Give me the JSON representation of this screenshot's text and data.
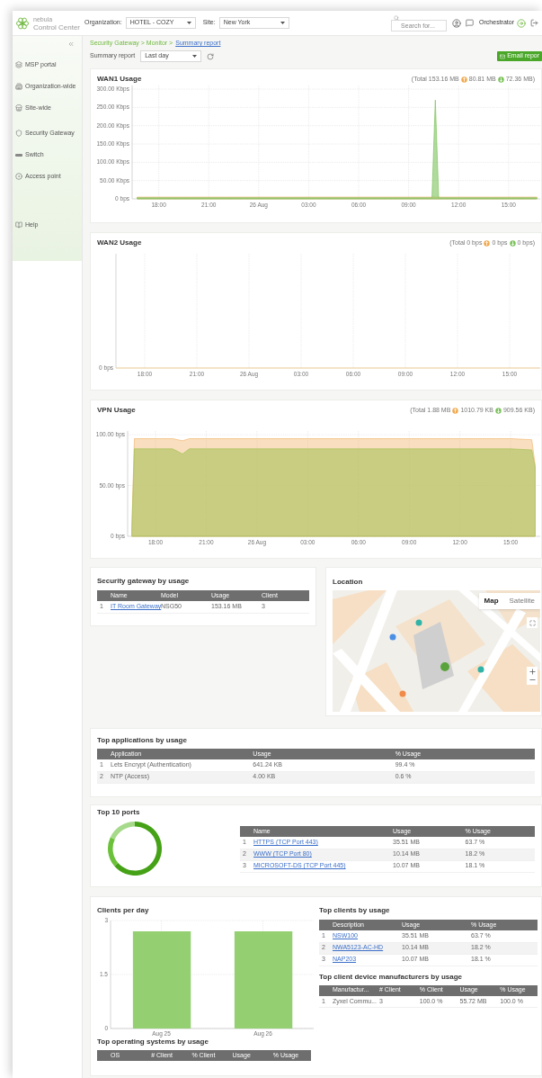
{
  "header": {
    "brand": "nebula",
    "subtitle": "Control Center",
    "organization_label": "Organization:",
    "organization": "HOTEL - COZY",
    "site_label": "Site:",
    "site": "New York",
    "search": {
      "placeholder": "Search for..."
    },
    "user": "Orchestrator"
  },
  "sidebar": {
    "sections": [
      {
        "items": [
          {
            "label": "MSP portal"
          },
          {
            "label": "Organization-wide"
          },
          {
            "label": "Site-wide"
          }
        ]
      },
      {
        "items": [
          {
            "label": "Security Gateway"
          },
          {
            "label": "Switch"
          },
          {
            "label": "Access point"
          }
        ]
      },
      {
        "items": [
          {
            "label": "Help"
          }
        ]
      }
    ]
  },
  "breadcrumb": {
    "path": "Security Gateway > Monitor >",
    "current": "Summary report"
  },
  "toolbar": {
    "label": "Summary report",
    "period": "Last day",
    "email_button": "Email repor"
  },
  "usage_charts": [
    {
      "title": "WAN1 Usage",
      "total": "(Total 153.16 MB",
      "upload": "80.81 MB",
      "download": "72.36 MB)",
      "chart_data": {
        "type": "area",
        "grid": true,
        "x": [
          "--08-25T16:42",
          "--08-25T18:00",
          "--08-25T20:00",
          "--08-25T22:00",
          "--08-26T00:00",
          "--08-26T02:00",
          "--08-26T04:00",
          "--08-26T06:00",
          "--08-26T08:00",
          "--08-26T10:00",
          "--08-26T10:24",
          "--08-26T10:36",
          "--08-26T10:48",
          "--08-26T12:00",
          "--08-26T14:00",
          "--08-26T16:00",
          "--08-26T16:42"
        ],
        "series": [
          {
            "color": "#f2b872",
            "values": [
              5,
              5,
              5,
              5,
              5,
              5,
              5,
              5,
              5,
              5,
              5,
              5,
              5,
              5,
              5,
              5,
              5
            ]
          },
          {
            "color": "#7cc35c",
            "values": [
              3,
              3,
              3,
              3,
              3,
              3,
              3,
              3,
              3,
              3,
              3,
              270,
              3,
              3,
              3,
              3,
              3
            ]
          }
        ],
        "xlim": [
          "--08-25T16:24",
          "--08-26T16:54"
        ],
        "ylim": [
          0,
          300
        ],
        "xticks": [
          {
            "value": "--08-25T18:00",
            "label": "18:00"
          },
          {
            "value": "--08-25T21:00",
            "label": "21:00"
          },
          {
            "value": "--08-26T00:00",
            "label": "26 Aug"
          },
          {
            "value": "--08-26T03:00",
            "label": "03:00"
          },
          {
            "value": "--08-26T06:00",
            "label": "06:00"
          },
          {
            "value": "--08-26T09:00",
            "label": "09:00"
          },
          {
            "value": "--08-26T12:00",
            "label": "12:00"
          },
          {
            "value": "--08-26T15:00",
            "label": "15:00"
          }
        ],
        "yticks": [
          {
            "value": 0,
            "label": "0 bps"
          },
          {
            "value": 50,
            "label": "50.00 Kbps"
          },
          {
            "value": 100,
            "label": "100.00 Kbps"
          },
          {
            "value": 150,
            "label": "150.00 Kbps"
          },
          {
            "value": 200,
            "label": "200.00 Kbps"
          },
          {
            "value": 250,
            "label": "250.00 Kbps"
          },
          {
            "value": 300,
            "label": "300.00 Kbps"
          }
        ]
      }
    },
    {
      "title": "WAN2 Usage",
      "total": "(Total 0 bps",
      "upload": "0 bps",
      "download": "0 bps)",
      "axis": {
        "y_label": "0 bps",
        "x_labels": [
          "18:00",
          "21:00",
          "26 Aug",
          "03:00",
          "06:00",
          "09:00",
          "12:00",
          "15:00"
        ]
      }
    },
    {
      "title": "VPN Usage",
      "total": "(Total 1.88 MB",
      "upload": "1010.79 KB",
      "download": "909.56 KB)",
      "chart_data": {
        "type": "area",
        "grid": true,
        "x": [
          "--08-25T16:36",
          "--08-25T16:45",
          "--08-25T18:00",
          "--08-25T19:00",
          "--08-25T19:36",
          "--08-25T20:00",
          "--08-25T21:00",
          "--08-26T00:00",
          "--08-26T03:00",
          "--08-26T06:00",
          "--08-26T09:00",
          "--08-26T12:00",
          "--08-26T15:00",
          "--08-26T16:15",
          "--08-26T16:27"
        ],
        "series": [
          {
            "color": "#f2b872",
            "values": [
              10,
              96,
              96,
              96,
              94,
              96,
              96,
              96,
              96,
              96,
              96,
              96,
              96,
              95,
              70
            ]
          },
          {
            "color": "#a8c25a",
            "values": [
              5,
              86,
              86,
              86,
              81,
              86,
              86,
              86,
              86,
              86,
              86,
              86,
              86,
              85,
              68
            ]
          }
        ],
        "xlim": [
          "--08-25T16:21",
          "--08-26T16:45"
        ],
        "ylim": [
          0,
          100
        ],
        "xticks": [
          {
            "value": "--08-25T18:00",
            "label": "18:00"
          },
          {
            "value": "--08-25T21:00",
            "label": "21:00"
          },
          {
            "value": "--08-26T00:00",
            "label": "26 Aug"
          },
          {
            "value": "--08-26T03:00",
            "label": "03:00"
          },
          {
            "value": "--08-26T06:00",
            "label": "06:00"
          },
          {
            "value": "--08-26T09:00",
            "label": "09:00"
          },
          {
            "value": "--08-26T12:00",
            "label": "12:00"
          },
          {
            "value": "--08-26T15:00",
            "label": "15:00"
          }
        ],
        "yticks": [
          {
            "value": 0,
            "label": "0 bps"
          },
          {
            "value": 50,
            "label": "50.00 bps"
          },
          {
            "value": 100,
            "label": "100.00 bps"
          }
        ]
      }
    }
  ],
  "gateway_usage": {
    "title": "Security gateway by usage",
    "table": {
      "columns": [
        "",
        "Name",
        "Model",
        "Usage",
        "Client"
      ],
      "rows": [
        {
          "cells": [
            "1",
            "IT Room Gateway",
            "NSG50",
            "153.16 MB",
            "3"
          ]
        }
      ]
    }
  },
  "location": {
    "title": "Location",
    "map_types": [
      {
        "label": "Map",
        "selected": true
      },
      {
        "label": "Satellite",
        "selected": false
      }
    ]
  },
  "top_applications": {
    "title": "Top applications by usage",
    "table": {
      "columns": [
        "",
        "Application",
        "Usage",
        "% Usage"
      ],
      "rows": [
        {
          "cells": [
            "1",
            "Lets Encrypt (Authentication)",
            "641.24 KB",
            "99.4 %"
          ]
        },
        {
          "cells": [
            "2",
            "NTP (Access)",
            "4.00 KB",
            "0.6 %"
          ]
        }
      ]
    }
  },
  "top_ports": {
    "title": "Top 10 ports",
    "chart_data": {
      "type": "donut",
      "values": [
        63.7,
        18.2,
        18.1
      ],
      "colors": [
        "#45a116",
        "#6cc13a",
        "#a6d98a"
      ]
    },
    "table": {
      "columns": [
        "",
        "Name",
        "Usage",
        "% Usage"
      ],
      "rows": [
        {
          "cells": [
            "1",
            "HTTPS (TCP Port 443)",
            "35.51 MB",
            "63.7 %"
          ]
        },
        {
          "cells": [
            "2",
            "WWW (TCP Port 80)",
            "10.14 MB",
            "18.2 %"
          ]
        },
        {
          "cells": [
            "3",
            "MICROSOFT-DS (TCP Port 445)",
            "10.07 MB",
            "18.1 %"
          ]
        }
      ]
    }
  },
  "clients_per_day": {
    "title": "Clients per day",
    "chart_data": {
      "type": "bar",
      "grid": true,
      "categories": [
        "Aug 25",
        "Aug 26"
      ],
      "values": [
        2.7,
        2.7
      ],
      "ylim": [
        0,
        3
      ],
      "yticks": [
        {
          "value": 0,
          "label": "0"
        },
        {
          "value": 1.5,
          "label": "1.5"
        },
        {
          "value": 3,
          "label": "3"
        }
      ]
    }
  },
  "top_os": {
    "title": "Top operating systems by usage",
    "table": {
      "columns": [
        "",
        "OS",
        "# Client",
        "% Client",
        "Usage",
        "% Usage"
      ]
    }
  },
  "top_clients": {
    "title": "Top clients by usage",
    "table": {
      "columns": [
        "",
        "Description",
        "Usage",
        "% Usage"
      ],
      "rows": [
        {
          "cells": [
            "1",
            "NSW100",
            "35.51 MB",
            "63.7 %"
          ]
        },
        {
          "cells": [
            "2",
            "NWA5123-AC-HD",
            "10.14 MB",
            "18.2 %"
          ]
        },
        {
          "cells": [
            "3",
            "NAP203",
            "10.07 MB",
            "18.1 %"
          ]
        }
      ]
    }
  },
  "top_manufacturers": {
    "title": "Top client device manufacturers by usage",
    "table": {
      "columns": [
        "",
        "Manufactur...",
        "# Client",
        "% Client",
        "Usage",
        "% Usage"
      ],
      "rows": [
        {
          "cells": [
            "1",
            "Zyxel Commu...",
            "3",
            "100.0 %",
            "55.72 MB",
            "100.0 %"
          ]
        }
      ]
    }
  }
}
